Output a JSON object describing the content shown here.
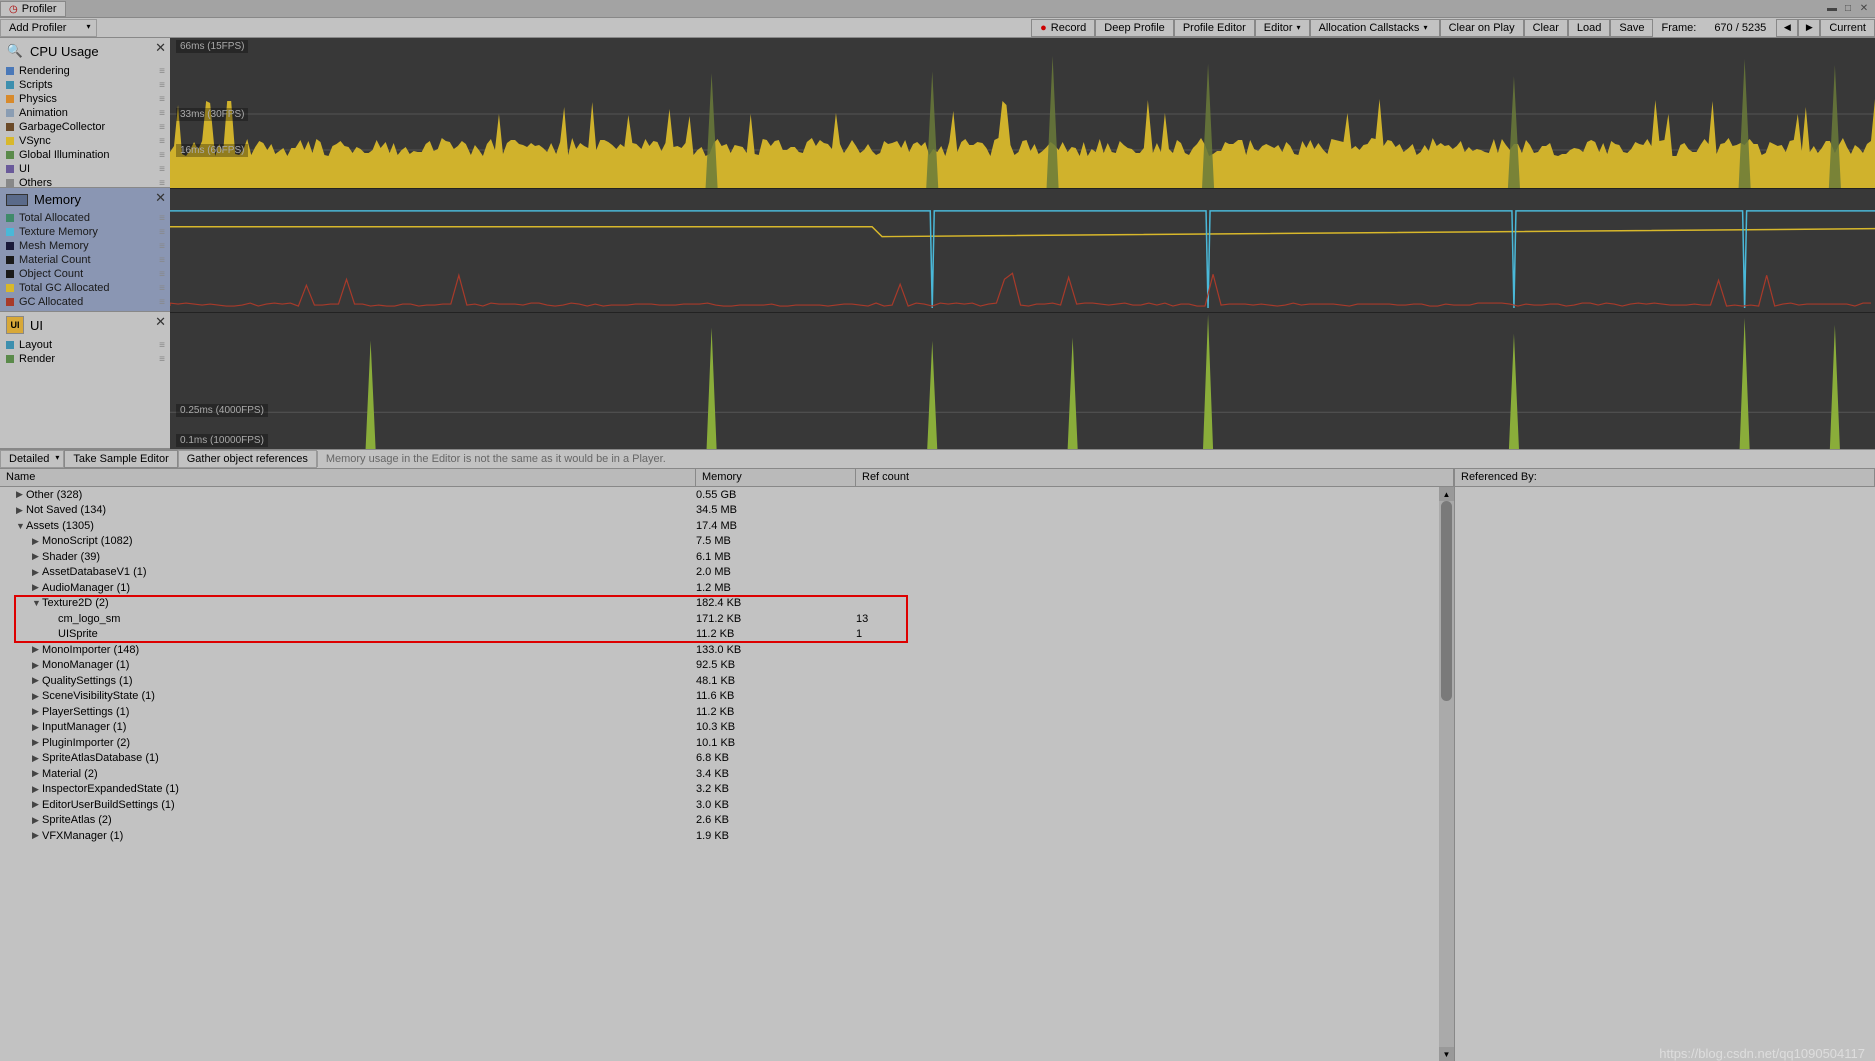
{
  "tab_title": "Profiler",
  "add_profiler": "Add Profiler",
  "toolbar": {
    "record": "Record",
    "deep_profile": "Deep Profile",
    "profile_editor": "Profile Editor",
    "editor": "Editor",
    "allocation_callstacks": "Allocation Callstacks",
    "clear_on_play": "Clear on Play",
    "clear": "Clear",
    "load": "Load",
    "save": "Save",
    "frame_label": "Frame:",
    "frame_value": "670 / 5235",
    "current": "Current"
  },
  "panels": {
    "cpu": {
      "title": "CPU Usage",
      "items": [
        {
          "color": "#4a78b8",
          "label": "Rendering"
        },
        {
          "color": "#3d8fae",
          "label": "Scripts"
        },
        {
          "color": "#d88a2b",
          "label": "Physics"
        },
        {
          "color": "#8a9db3",
          "label": "Animation"
        },
        {
          "color": "#6b4a28",
          "label": "GarbageCollector"
        },
        {
          "color": "#d8b82b",
          "label": "VSync"
        },
        {
          "color": "#5a8a4a",
          "label": "Global Illumination"
        },
        {
          "color": "#6a5a9a",
          "label": "UI"
        },
        {
          "color": "#888",
          "label": "Others"
        }
      ]
    },
    "memory": {
      "title": "Memory",
      "items": [
        {
          "color": "#3f8a6a",
          "label": "Total Allocated"
        },
        {
          "color": "#4ab8d8",
          "label": "Texture Memory"
        },
        {
          "color": "#1a1a3a",
          "label": "Mesh Memory"
        },
        {
          "color": "#1a1a1a",
          "label": "Material Count"
        },
        {
          "color": "#1a1a1a",
          "label": "Object Count"
        },
        {
          "color": "#d8b82b",
          "label": "Total GC Allocated"
        },
        {
          "color": "#a83a2a",
          "label": "GC Allocated"
        }
      ]
    },
    "ui": {
      "title": "UI",
      "items": [
        {
          "color": "#3d8fae",
          "label": "Layout"
        },
        {
          "color": "#5a8a4a",
          "label": "Render"
        }
      ]
    }
  },
  "chart_labels": {
    "cpu_66": "66ms (15FPS)",
    "cpu_33": "33ms (30FPS)",
    "cpu_16": "16ms (60FPS)",
    "ui_025": "0.25ms (4000FPS)",
    "ui_01": "0.1ms (10000FPS)"
  },
  "lower_toolbar": {
    "detailed": "Detailed",
    "take_sample": "Take Sample Editor",
    "gather": "Gather object references",
    "info": "Memory usage in the Editor is not the same as it would be in a Player."
  },
  "columns": {
    "name": "Name",
    "memory": "Memory",
    "refcount": "Ref count",
    "referenced_by": "Referenced By:"
  },
  "rows": [
    {
      "indent": 0,
      "arrow": "▶",
      "name": "Other (328)",
      "mem": "0.55 GB",
      "ref": ""
    },
    {
      "indent": 0,
      "arrow": "▶",
      "name": "Not Saved (134)",
      "mem": "34.5 MB",
      "ref": ""
    },
    {
      "indent": 0,
      "arrow": "▼",
      "name": "Assets (1305)",
      "mem": "17.4 MB",
      "ref": ""
    },
    {
      "indent": 1,
      "arrow": "▶",
      "name": "MonoScript (1082)",
      "mem": "7.5 MB",
      "ref": ""
    },
    {
      "indent": 1,
      "arrow": "▶",
      "name": "Shader (39)",
      "mem": "6.1 MB",
      "ref": ""
    },
    {
      "indent": 1,
      "arrow": "▶",
      "name": "AssetDatabaseV1 (1)",
      "mem": "2.0 MB",
      "ref": ""
    },
    {
      "indent": 1,
      "arrow": "▶",
      "name": "AudioManager (1)",
      "mem": "1.2 MB",
      "ref": ""
    },
    {
      "indent": 1,
      "arrow": "▼",
      "name": "Texture2D (2)",
      "mem": "182.4 KB",
      "ref": ""
    },
    {
      "indent": 2,
      "arrow": "",
      "name": "cm_logo_sm",
      "mem": "171.2 KB",
      "ref": "13"
    },
    {
      "indent": 2,
      "arrow": "",
      "name": "UISprite",
      "mem": "11.2 KB",
      "ref": "1"
    },
    {
      "indent": 1,
      "arrow": "▶",
      "name": "MonoImporter (148)",
      "mem": "133.0 KB",
      "ref": ""
    },
    {
      "indent": 1,
      "arrow": "▶",
      "name": "MonoManager (1)",
      "mem": "92.5 KB",
      "ref": ""
    },
    {
      "indent": 1,
      "arrow": "▶",
      "name": "QualitySettings (1)",
      "mem": "48.1 KB",
      "ref": ""
    },
    {
      "indent": 1,
      "arrow": "▶",
      "name": "SceneVisibilityState (1)",
      "mem": "11.6 KB",
      "ref": ""
    },
    {
      "indent": 1,
      "arrow": "▶",
      "name": "PlayerSettings (1)",
      "mem": "11.2 KB",
      "ref": ""
    },
    {
      "indent": 1,
      "arrow": "▶",
      "name": "InputManager (1)",
      "mem": "10.3 KB",
      "ref": ""
    },
    {
      "indent": 1,
      "arrow": "▶",
      "name": "PluginImporter (2)",
      "mem": "10.1 KB",
      "ref": ""
    },
    {
      "indent": 1,
      "arrow": "▶",
      "name": "SpriteAtlasDatabase (1)",
      "mem": "6.8 KB",
      "ref": ""
    },
    {
      "indent": 1,
      "arrow": "▶",
      "name": "Material (2)",
      "mem": "3.4 KB",
      "ref": ""
    },
    {
      "indent": 1,
      "arrow": "▶",
      "name": "InspectorExpandedState (1)",
      "mem": "3.2 KB",
      "ref": ""
    },
    {
      "indent": 1,
      "arrow": "▶",
      "name": "EditorUserBuildSettings (1)",
      "mem": "3.0 KB",
      "ref": ""
    },
    {
      "indent": 1,
      "arrow": "▶",
      "name": "SpriteAtlas (2)",
      "mem": "2.6 KB",
      "ref": ""
    },
    {
      "indent": 1,
      "arrow": "▶",
      "name": "VFXManager (1)",
      "mem": "1.9 KB",
      "ref": ""
    }
  ],
  "watermark": "https://blog.csdn.net/qq1090504117"
}
